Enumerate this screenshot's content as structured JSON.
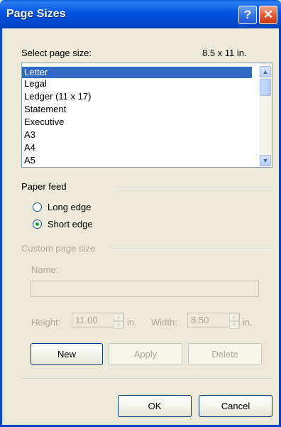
{
  "window": {
    "title": "Page Sizes"
  },
  "page_size": {
    "label": "Select page size:",
    "current": "8.5 x 11 in.",
    "items": [
      "Letter",
      "Legal",
      "Ledger (11 x 17)",
      "Statement",
      "Executive",
      "A3",
      "A4",
      "A5"
    ],
    "selected": "Letter"
  },
  "paper_feed": {
    "label": "Paper feed",
    "options": [
      "Long edge",
      "Short edge"
    ],
    "selected": "Short edge"
  },
  "custom_page_size": {
    "label": "Custom page size",
    "name_label": "Name:",
    "name_value": "",
    "height_label": "Height:",
    "height_value": "11.00",
    "height_unit": "in.",
    "width_label": "Width:",
    "width_value": "8.50",
    "width_unit": "in."
  },
  "buttons": {
    "new": "New",
    "apply": "Apply",
    "delete": "Delete",
    "ok": "OK",
    "cancel": "Cancel"
  },
  "colors": {
    "title_bar": "#0054e3",
    "selection": "#316ac5",
    "dialog_bg": "#ece9d8"
  }
}
